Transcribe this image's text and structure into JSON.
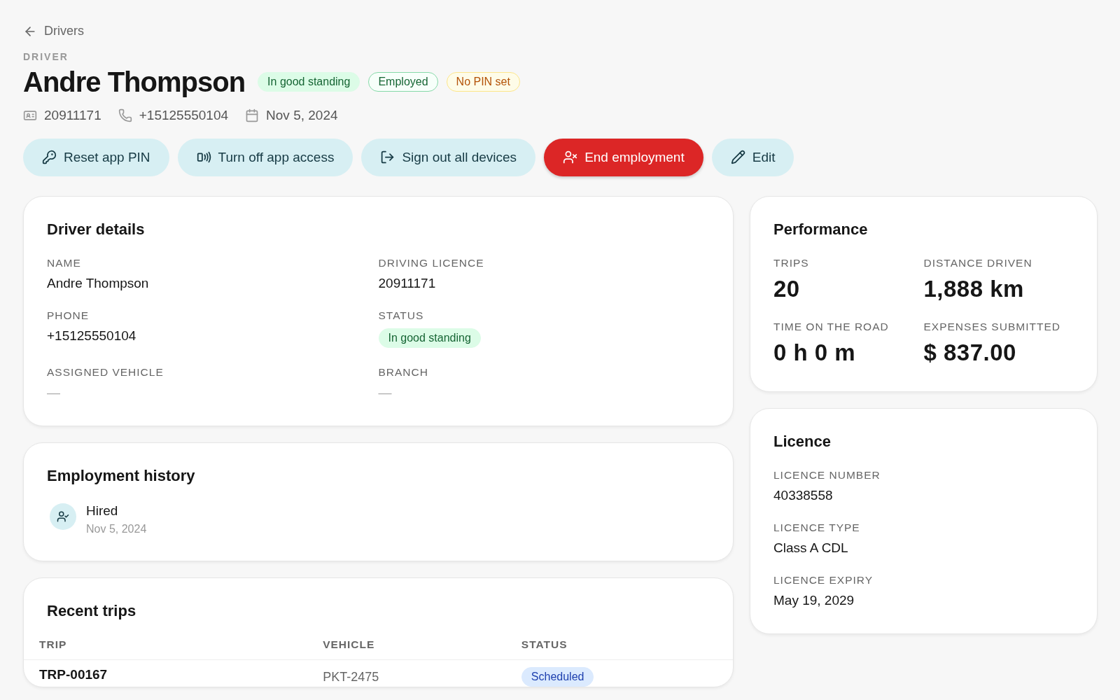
{
  "back_link": {
    "label": "Drivers"
  },
  "eyebrow": "DRIVER",
  "title": "Andre Thompson",
  "badges": [
    {
      "label": "In good standing",
      "kind": "success"
    },
    {
      "label": "Employed",
      "kind": "outline"
    },
    {
      "label": "No PIN set",
      "kind": "warning"
    }
  ],
  "meta": [
    {
      "kind": "licence",
      "text": "20911171"
    },
    {
      "kind": "phone",
      "text": "+15125550104"
    },
    {
      "kind": "date",
      "text": "Nov 5, 2024"
    }
  ],
  "actions": [
    {
      "label": "Reset app PIN",
      "kind": "pin"
    },
    {
      "label": "Turn off app access",
      "kind": "access"
    },
    {
      "label": "Sign out all devices",
      "kind": "signout"
    },
    {
      "label": "End employment",
      "kind": "end"
    },
    {
      "label": "Edit",
      "kind": "edit"
    }
  ],
  "driver_details": {
    "title": "Driver details",
    "fields": [
      {
        "label": "NAME",
        "value": "Andre Thompson"
      },
      {
        "label": "DRIVING LICENCE",
        "value": "20911171"
      },
      {
        "label": "PHONE",
        "value": "+15125550104"
      },
      {
        "label": "STATUS",
        "badge": "In good standing"
      },
      {
        "label": "ASSIGNED VEHICLE",
        "value": "—",
        "empty": true
      },
      {
        "label": "BRANCH",
        "value": "—",
        "empty": true
      }
    ]
  },
  "employment_history": {
    "title": "Employment history",
    "events": [
      {
        "title": "Hired",
        "date": "Nov 5, 2024"
      }
    ]
  },
  "recent_trips": {
    "title": "Recent trips",
    "columns": [
      "TRIP",
      "VEHICLE",
      "STATUS"
    ],
    "rows": [
      {
        "trip": "TRP-00167",
        "vehicle": "PKT-2475",
        "status": "Scheduled"
      }
    ]
  },
  "performance": {
    "title": "Performance",
    "stats": [
      {
        "label": "TRIPS",
        "value": "20"
      },
      {
        "label": "DISTANCE DRIVEN",
        "value": "1,888 km"
      },
      {
        "label": "TIME ON THE ROAD",
        "value": "0 h 0 m"
      },
      {
        "label": "EXPENSES SUBMITTED",
        "value": "$ 837.00"
      }
    ]
  },
  "licence": {
    "title": "Licence",
    "fields": [
      {
        "label": "LICENCE NUMBER",
        "value": "40338558"
      },
      {
        "label": "LICENCE TYPE",
        "value": "Class A CDL"
      },
      {
        "label": "LICENCE EXPIRY",
        "value": "May 19, 2029"
      }
    ]
  }
}
